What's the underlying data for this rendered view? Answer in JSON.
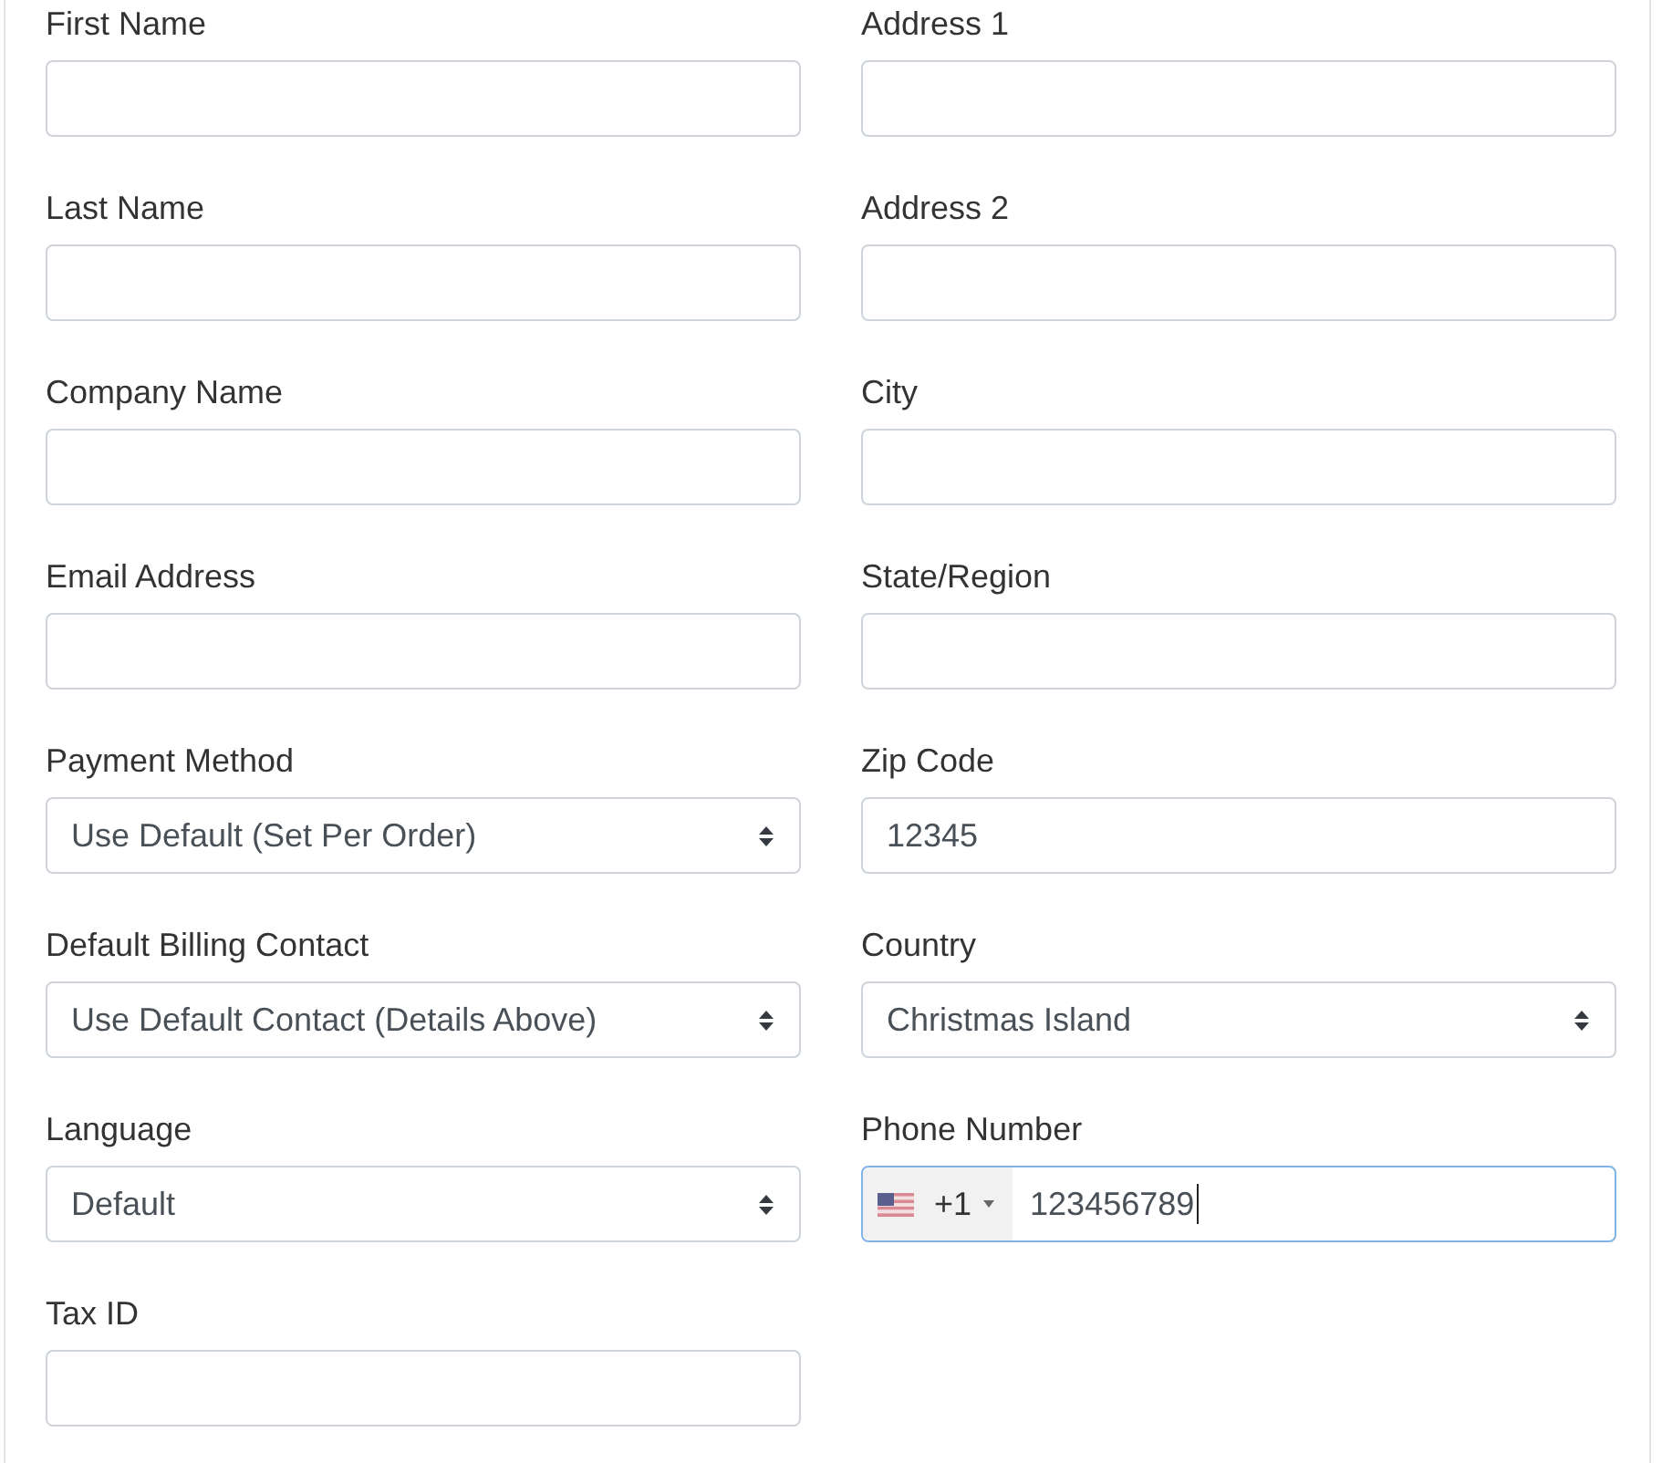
{
  "form": {
    "left_column": [
      {
        "label": "First Name",
        "kind": "text",
        "focused": false
      },
      {
        "label": "Last Name",
        "kind": "text",
        "focused": false
      },
      {
        "label": "Company Name",
        "kind": "text",
        "focused": false
      },
      {
        "label": "Email Address",
        "kind": "text",
        "focused": false
      },
      {
        "label": "Payment Method",
        "kind": "select",
        "value": "Use Default (Set Per Order)",
        "focused": false
      },
      {
        "label": "Default Billing Contact",
        "kind": "select",
        "value": "Use Default Contact (Details Above)",
        "focused": false
      },
      {
        "label": "Language",
        "kind": "select",
        "value": "Default",
        "focused": false
      },
      {
        "label": "Tax ID",
        "kind": "text",
        "focused": false
      }
    ],
    "right_column": [
      {
        "label": "Address 1",
        "kind": "text",
        "focused": false
      },
      {
        "label": "Address 2",
        "kind": "text",
        "focused": false
      },
      {
        "label": "City",
        "kind": "text",
        "focused": false
      },
      {
        "label": "State/Region",
        "kind": "text",
        "focused": false
      },
      {
        "label": "Zip Code",
        "kind": "text",
        "value": "12345",
        "focused": false
      },
      {
        "label": "Country",
        "kind": "select",
        "value": "Christmas Island",
        "focused": false
      },
      {
        "label": "Phone Number",
        "kind": "phone",
        "country_code": "+1",
        "value": "123456789",
        "focused": true
      }
    ]
  }
}
